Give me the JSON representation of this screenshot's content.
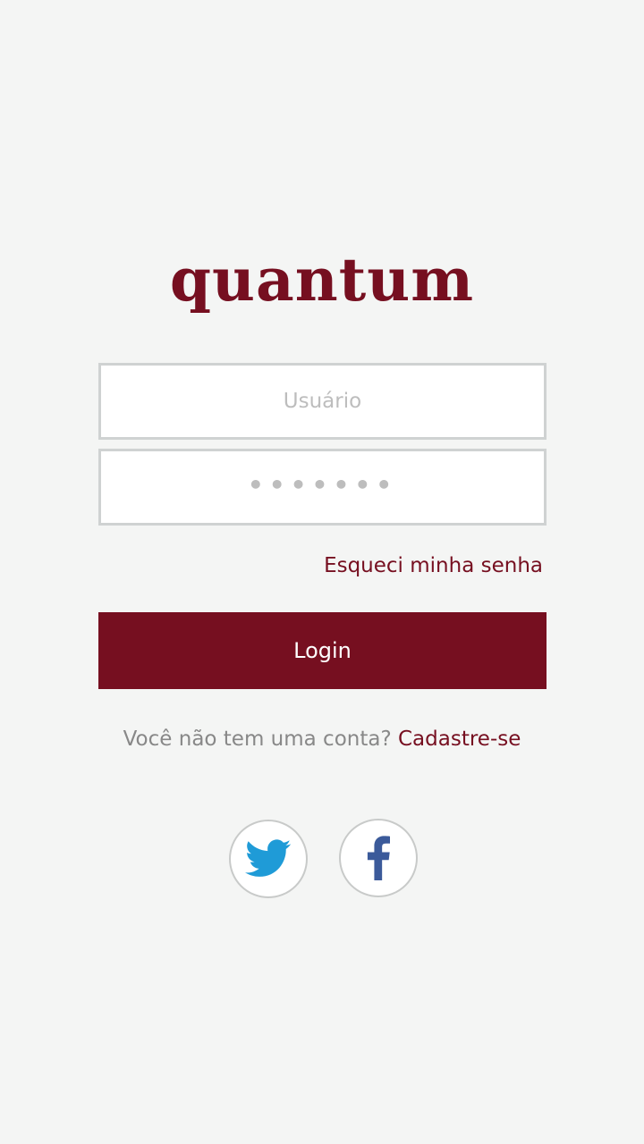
{
  "app": {
    "logo_text": "quantum"
  },
  "form": {
    "username_placeholder": "Usuário",
    "username_value": "",
    "password_placeholder": "•••••••",
    "password_value": "",
    "forgot_label": "Esqueci minha senha",
    "login_label": "Login"
  },
  "signup": {
    "prompt": "Você não tem uma conta?",
    "link_label": "Cadastre-se"
  },
  "social": {
    "twitter_icon": "twitter-icon",
    "facebook_icon": "facebook-icon"
  },
  "colors": {
    "brand": "#760f20",
    "background": "#f4f5f4",
    "twitter": "#1f9bd7",
    "facebook": "#3b5a9a"
  }
}
